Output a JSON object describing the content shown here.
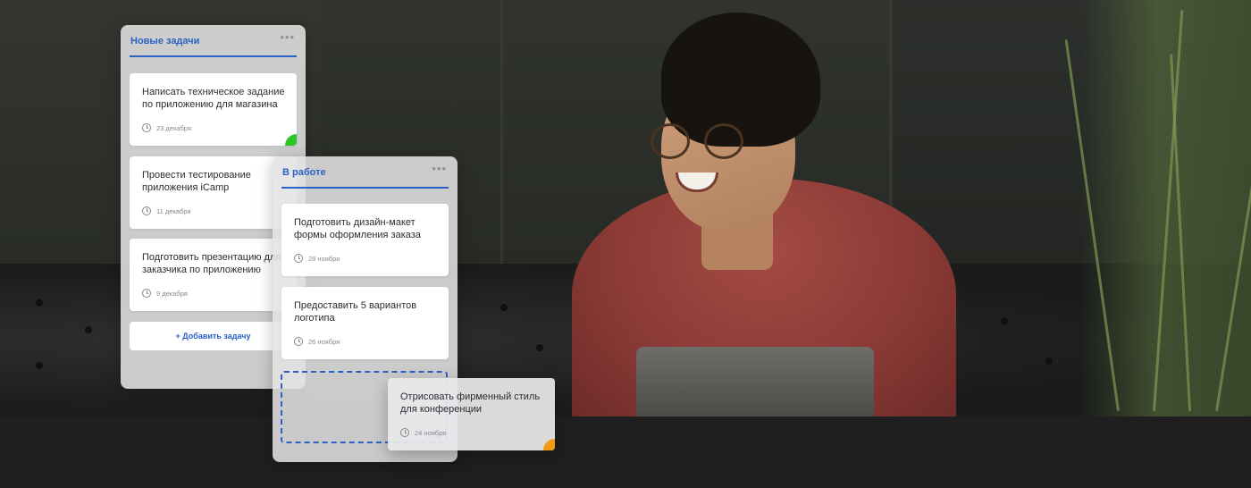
{
  "colors": {
    "accent": "#2a62c4",
    "done_flag": "#2ec527",
    "progress_flag": "#f19a12"
  },
  "columns": [
    {
      "title": "Новые задачи",
      "more_icon": "more-horizontal-icon",
      "cards": [
        {
          "title": "Написать техническое задание\nпо приложению для магазина",
          "date": "23 декабря",
          "flag": "green"
        },
        {
          "title": "Провести тестирование\nприложения iCamp",
          "date": "11 декабря"
        },
        {
          "title": "Подготовить презентацию для\nзаказчика по приложению",
          "date": "9 декабря"
        }
      ],
      "add_label": "+ Добавить задачу"
    },
    {
      "title": "В работе",
      "more_icon": "more-horizontal-icon",
      "cards": [
        {
          "title": "Подготовить дизайн-макет\nформы оформления заказа",
          "date": "28 ноября"
        },
        {
          "title": "Предоставить 5 вариантов\nлоготипа",
          "date": "26 ноября"
        }
      ]
    }
  ],
  "dragging_card": {
    "title": "Отрисовать фирменный стиль\nдля конференции",
    "date": "24 ноября",
    "flag": "orange"
  },
  "more_glyph": "•••"
}
